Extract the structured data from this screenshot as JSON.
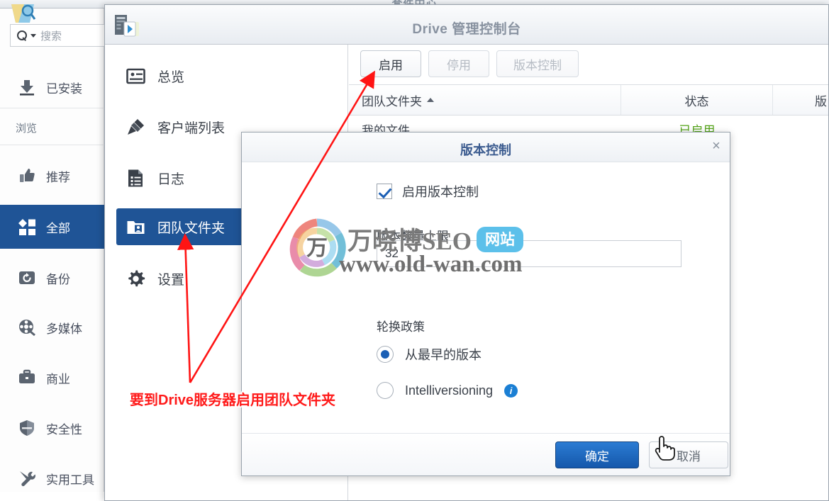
{
  "package_center": {
    "title": "套件中心",
    "search": {
      "placeholder": "搜索"
    },
    "items": [
      {
        "label": "已安装",
        "icon": "download-icon"
      },
      {
        "label": "推荐",
        "icon": "thumbs-up-icon"
      },
      {
        "label": "全部",
        "icon": "grid-icon"
      },
      {
        "label": "备份",
        "icon": "backup-icon"
      },
      {
        "label": "多媒体",
        "icon": "film-reel-icon"
      },
      {
        "label": "商业",
        "icon": "briefcase-icon"
      },
      {
        "label": "安全性",
        "icon": "shield-icon"
      },
      {
        "label": "实用工具",
        "icon": "tools-icon"
      }
    ],
    "section_label": "浏览"
  },
  "drive_console": {
    "title": "Drive 管理控制台",
    "nav": [
      {
        "label": "总览",
        "icon": "overview-icon"
      },
      {
        "label": "客户端列表",
        "icon": "plug-icon"
      },
      {
        "label": "日志",
        "icon": "log-icon"
      },
      {
        "label": "团队文件夹",
        "icon": "team-folder-icon"
      },
      {
        "label": "设置",
        "icon": "gear-icon"
      }
    ],
    "toolbar": {
      "enable_label": "启用",
      "disable_label": "停用",
      "version_control_label": "版本控制"
    },
    "table": {
      "headers": [
        "团队文件夹",
        "状态",
        "版"
      ],
      "sort_column": "团队文件夹",
      "sort_direction": "asc",
      "rows": [
        {
          "folder": "我的文件",
          "status": "已启用",
          "version": ""
        }
      ],
      "status_color": "#53a318"
    }
  },
  "version_dialog": {
    "title": "版本控制",
    "close_label": "×",
    "enable_checkbox_label": "启用版本控制",
    "enable_checkbox_checked": true,
    "limit_label": "版本数量上限",
    "limit_value": "32",
    "rotation_label": "轮换政策",
    "rotation_options": [
      {
        "label": "从最早的版本",
        "selected": true
      },
      {
        "label": "Intelliversioning",
        "selected": false,
        "info": "i"
      }
    ],
    "ok_label": "确定",
    "cancel_label": "取消"
  },
  "annotation": {
    "note": "要到Drive服务器启用团队文件夹",
    "color": "#ff1a1a"
  },
  "watermark": {
    "line1": "万晓博SEO",
    "badge": "网站",
    "line2": "www.old-wan.com",
    "logo_char": "万"
  }
}
